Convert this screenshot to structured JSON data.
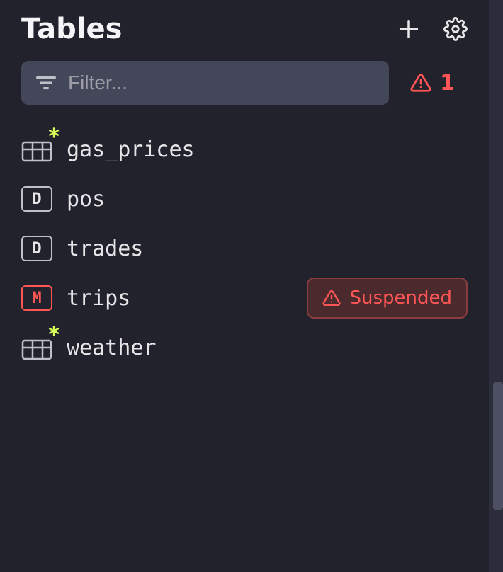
{
  "header": {
    "title": "Tables"
  },
  "filter": {
    "placeholder": "Filter..."
  },
  "warning": {
    "count": "1"
  },
  "tables": [
    {
      "name": "gas_prices",
      "icon": "table-star",
      "status": null
    },
    {
      "name": "pos",
      "icon": "D",
      "status": null
    },
    {
      "name": "trades",
      "icon": "D",
      "status": null
    },
    {
      "name": "trips",
      "icon": "M",
      "status": "Suspended"
    },
    {
      "name": "weather",
      "icon": "table-star",
      "status": null
    }
  ],
  "status_labels": {
    "suspended": "Suspended"
  }
}
